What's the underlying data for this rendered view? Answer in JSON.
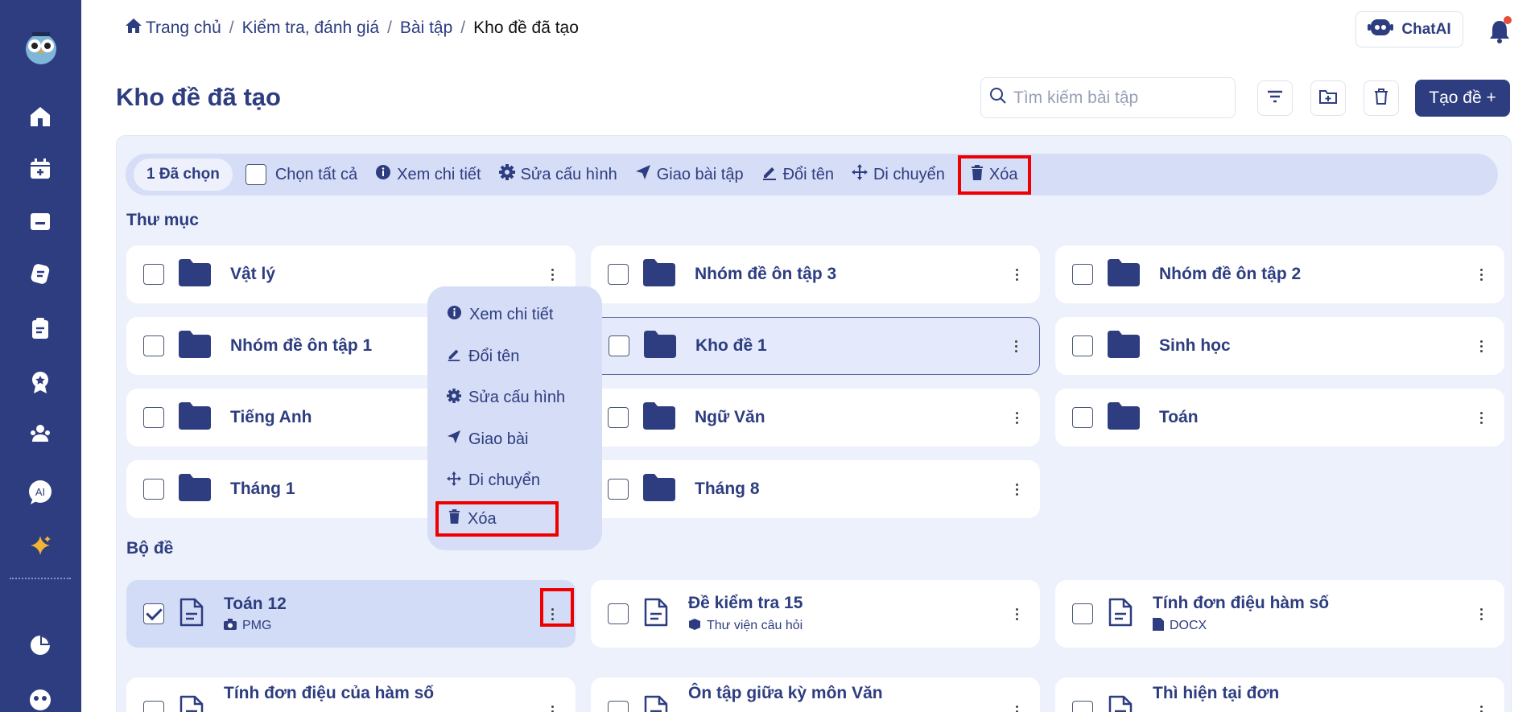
{
  "breadcrumb": {
    "home": "Trang chủ",
    "item2": "Kiểm tra, đánh giá",
    "item3": "Bài tập",
    "current": "Kho đề đã tạo",
    "separator": "/"
  },
  "header": {
    "chatai_label": "ChatAI"
  },
  "page": {
    "title": "Kho đề đã tạo",
    "search_placeholder": "Tìm kiếm bài tập",
    "create_label": "Tạo đề +"
  },
  "toolbar": {
    "selected": "1 Đã chọn",
    "select_all": "Chọn tất cả",
    "view_details": "Xem chi tiết",
    "edit_config": "Sửa cấu hình",
    "assign": "Giao bài tập",
    "rename": "Đổi tên",
    "move": "Di chuyển",
    "delete": "Xóa"
  },
  "sections": {
    "folders": "Thư mục",
    "sets": "Bộ đề"
  },
  "folders": [
    {
      "name": "Vật lý"
    },
    {
      "name": "Nhóm đề ôn tập 3"
    },
    {
      "name": "Nhóm đề ôn tập 2"
    },
    {
      "name": "Nhóm đề ôn tập 1"
    },
    {
      "name": "Kho đề 1"
    },
    {
      "name": "Sinh học"
    },
    {
      "name": "Tiếng Anh"
    },
    {
      "name": "Ngữ Văn"
    },
    {
      "name": "Toán"
    },
    {
      "name": "Tháng 1"
    },
    {
      "name": "Tháng 8"
    }
  ],
  "sets": [
    {
      "name": "Toán 12",
      "sub": "PMG",
      "icon": "camera-icon",
      "checked": true
    },
    {
      "name": "Đề kiểm tra 15",
      "sub": "Thư viện câu hỏi",
      "icon": "library-icon",
      "checked": false
    },
    {
      "name": "Tính đơn điệu hàm số",
      "sub": "DOCX",
      "icon": "docx-icon",
      "checked": false
    },
    {
      "name": "Tính đơn điệu của hàm số"
    },
    {
      "name": "Ôn tập giữa kỳ môn Văn"
    },
    {
      "name": "Thì hiện tại đơn"
    }
  ],
  "context_menu": {
    "view_details": "Xem chi tiết",
    "rename": "Đổi tên",
    "edit_config": "Sửa cấu hình",
    "assign": "Giao bài",
    "move": "Di chuyển",
    "delete": "Xóa"
  },
  "colors": {
    "primary": "#2d3d80",
    "highlight": "#e00000",
    "panel": "#edf1fb",
    "toolbar": "#d6ddf6",
    "notification_dot": "#e74c3c"
  }
}
